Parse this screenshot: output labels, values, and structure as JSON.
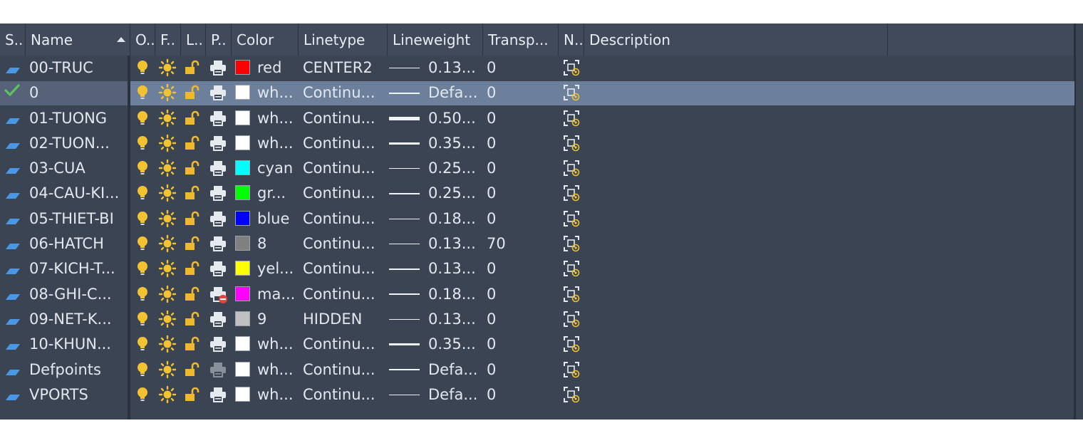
{
  "columns": {
    "status": "S..",
    "name": "Name",
    "on": "O..",
    "freeze": "F..",
    "lock": "L..",
    "plot": "P..",
    "color": "Color",
    "linetype": "Linetype",
    "lineweight": "Lineweight",
    "transparency": "Transp...",
    "newvp": "N..",
    "description": "Description"
  },
  "colors": {
    "bulb": "#f2c230",
    "sun": "#f2c230",
    "lock": "#f0b82c",
    "current_check": "#5cc45c",
    "layer_icon": "#4a97e6"
  },
  "layers": [
    {
      "name": "00-TRUC",
      "current": false,
      "color_name": "red",
      "color_hex": "#ff0000",
      "linetype": "CENTER2",
      "lw_display": "0.13...",
      "lw_weight": "thin",
      "transparency": "0",
      "plot": true
    },
    {
      "name": "0",
      "current": true,
      "color_name": "wh...",
      "color_hex": "#ffffff",
      "linetype": "Continu...",
      "lw_display": "Defa...",
      "lw_weight": "thin",
      "transparency": "0",
      "plot": true
    },
    {
      "name": "01-TUONG",
      "current": false,
      "color_name": "wh...",
      "color_hex": "#ffffff",
      "linetype": "Continu...",
      "lw_display": "0.50...",
      "lw_weight": "thick",
      "transparency": "0",
      "plot": true
    },
    {
      "name": "02-TUON...",
      "current": false,
      "color_name": "wh...",
      "color_hex": "#ffffff",
      "linetype": "Continu...",
      "lw_display": "0.35...",
      "lw_weight": "medium",
      "transparency": "0",
      "plot": true
    },
    {
      "name": "03-CUA",
      "current": false,
      "color_name": "cyan",
      "color_hex": "#00ffff",
      "linetype": "Continu...",
      "lw_display": "0.25...",
      "lw_weight": "thin",
      "transparency": "0",
      "plot": true
    },
    {
      "name": "04-CAU-KI...",
      "current": false,
      "color_name": "gr...",
      "color_hex": "#00ff00",
      "linetype": "Continu...",
      "lw_display": "0.25...",
      "lw_weight": "thin",
      "transparency": "0",
      "plot": true
    },
    {
      "name": "05-THIET-BI",
      "current": false,
      "color_name": "blue",
      "color_hex": "#0000ff",
      "linetype": "Continu...",
      "lw_display": "0.18...",
      "lw_weight": "thin",
      "transparency": "0",
      "plot": true
    },
    {
      "name": "06-HATCH",
      "current": false,
      "color_name": "8",
      "color_hex": "#808080",
      "linetype": "Continu...",
      "lw_display": "0.13...",
      "lw_weight": "thin",
      "transparency": "70",
      "plot": true
    },
    {
      "name": "07-KICH-T...",
      "current": false,
      "color_name": "yel...",
      "color_hex": "#ffff00",
      "linetype": "Continu...",
      "lw_display": "0.13...",
      "lw_weight": "thin",
      "transparency": "0",
      "plot": true
    },
    {
      "name": "08-GHI-C...",
      "current": false,
      "color_name": "ma...",
      "color_hex": "#ff00ff",
      "linetype": "Continu...",
      "lw_display": "0.18...",
      "lw_weight": "thin",
      "transparency": "0",
      "plot": false
    },
    {
      "name": "09-NET-K...",
      "current": false,
      "color_name": "9",
      "color_hex": "#c0c0c0",
      "linetype": "HIDDEN",
      "lw_display": "0.13...",
      "lw_weight": "thin",
      "transparency": "0",
      "plot": true
    },
    {
      "name": "10-KHUN...",
      "current": false,
      "color_name": "wh...",
      "color_hex": "#ffffff",
      "linetype": "Continu...",
      "lw_display": "0.35...",
      "lw_weight": "medium",
      "transparency": "0",
      "plot": true
    },
    {
      "name": "Defpoints",
      "current": false,
      "color_name": "wh...",
      "color_hex": "#ffffff",
      "linetype": "Continu...",
      "lw_display": "Defa...",
      "lw_weight": "thin",
      "transparency": "0",
      "plot": "dim"
    },
    {
      "name": "VPORTS",
      "current": false,
      "color_name": "wh...",
      "color_hex": "#ffffff",
      "linetype": "Continu...",
      "lw_display": "Defa...",
      "lw_weight": "thin",
      "transparency": "0",
      "plot": true
    }
  ]
}
